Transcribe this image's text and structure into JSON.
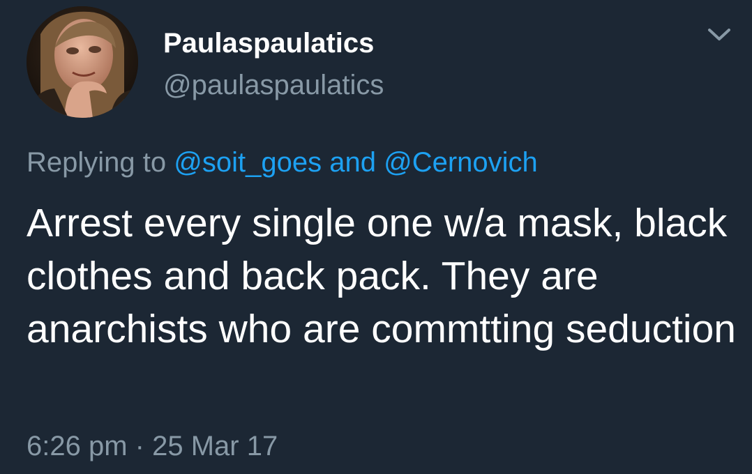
{
  "tweet": {
    "display_name": "Paulaspaulatics",
    "handle": "@paulaspaulatics",
    "reply": {
      "prefix": "Replying to",
      "mention_1": "@soit_goes",
      "conjunction": "and",
      "mention_2": "@Cernovich"
    },
    "text": "Arrest every single one w/a mask, black clothes and back pack. They are anarchists who are commtting seduction",
    "time": "6:26 pm",
    "separator": "·",
    "date": "25 Mar 17"
  },
  "icons": {
    "more": "chevron-down-icon"
  },
  "colors": {
    "background": "#1c2734",
    "primary_text": "#ffffff",
    "secondary_text": "#8899a6",
    "link": "#1da1f2"
  }
}
